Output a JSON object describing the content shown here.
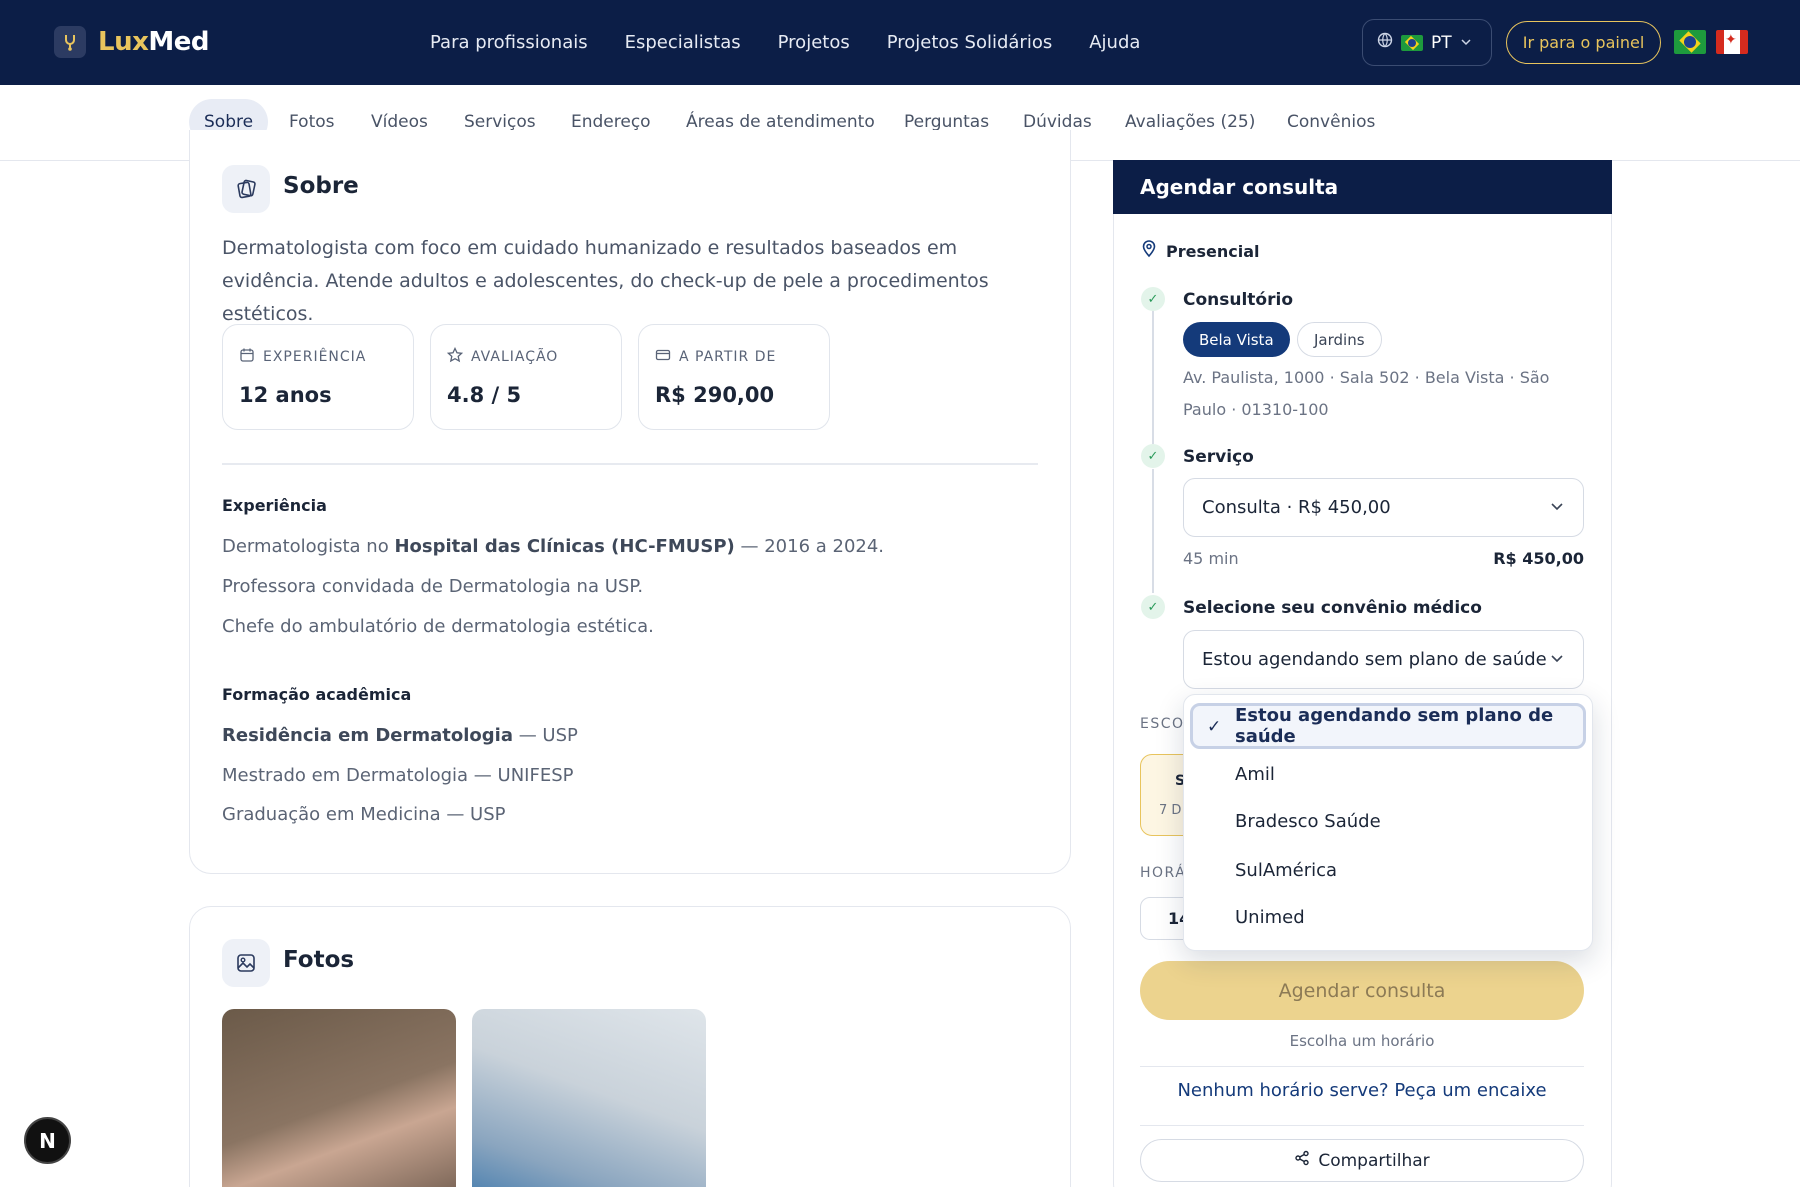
{
  "brand": {
    "part1": "Lux",
    "part2": "Med"
  },
  "nav": [
    "Para profissionais",
    "Especialistas",
    "Projetos",
    "Projetos Solidários",
    "Ajuda"
  ],
  "lang": {
    "code": "PT"
  },
  "panel_button": "Ir para o painel",
  "tabs": [
    "Sobre",
    "Fotos",
    "Vídeos",
    "Serviços",
    "Endereço",
    "Áreas de atendimento",
    "Perguntas",
    "Dúvidas",
    "Avaliações (25)",
    "Convênios"
  ],
  "about": {
    "title": "Sobre",
    "description": "Dermatologista com foco em cuidado humanizado e resultados baseados em evidência. Atende adultos e adolescentes, do check-up de pele a procedimentos estéticos.",
    "stats": [
      {
        "label": "EXPERIÊNCIA",
        "value": "12 anos"
      },
      {
        "label": "AVALIAÇÃO",
        "value": "4.8 / 5"
      },
      {
        "label": "A PARTIR DE",
        "value": "R$ 290,00"
      }
    ],
    "experience_title": "Experiência",
    "experience": {
      "l1_pre": "Dermatologista no ",
      "l1_bold": "Hospital das Clínicas (HC-FMUSP)",
      "l1_post": " — 2016 a 2024.",
      "l2": "Professora convidada de Dermatologia na USP.",
      "l3": "Chefe do ambulatório de dermatologia estética."
    },
    "education_title": "Formação acadêmica",
    "education": {
      "l1_bold": "Residência em Dermatologia",
      "l1_post": " — USP",
      "l2": "Mestrado em Dermatologia — UNIFESP",
      "l3": "Graduação em Medicina — USP"
    }
  },
  "photos": {
    "title": "Fotos"
  },
  "booking": {
    "header": "Agendar consulta",
    "mode": "Presencial",
    "office_title": "Consultório",
    "offices": [
      "Bela Vista",
      "Jardins"
    ],
    "address": "Av. Paulista, 1000 · Sala 502 · Bela Vista · São Paulo · 01310-100",
    "service_title": "Serviço",
    "service_value": "Consulta · R$ 450,00",
    "duration": "45 min",
    "price": "R$ 450,00",
    "insurance_title": "Selecione seu convênio médico",
    "insurance_value": "Estou agendando sem plano de saúde",
    "choose_label": "ESCO",
    "date_day": "S",
    "date_sub": "7 D",
    "time_label": "HORÁ",
    "time_value": "14",
    "book_button": "Agendar consulta",
    "hint": "Escolha um horário",
    "encaixe": "Nenhum horário serve? Peça um encaixe",
    "share": "Compartilhar"
  },
  "insurance_options": [
    "Estou agendando sem plano de saúde",
    "Amil",
    "Bradesco Saúde",
    "SulAmérica",
    "Unimed"
  ],
  "badge": "N",
  "colors": {
    "navy": "#0c1e47",
    "gold": "#e8c45d",
    "accent": "#143a7a"
  }
}
